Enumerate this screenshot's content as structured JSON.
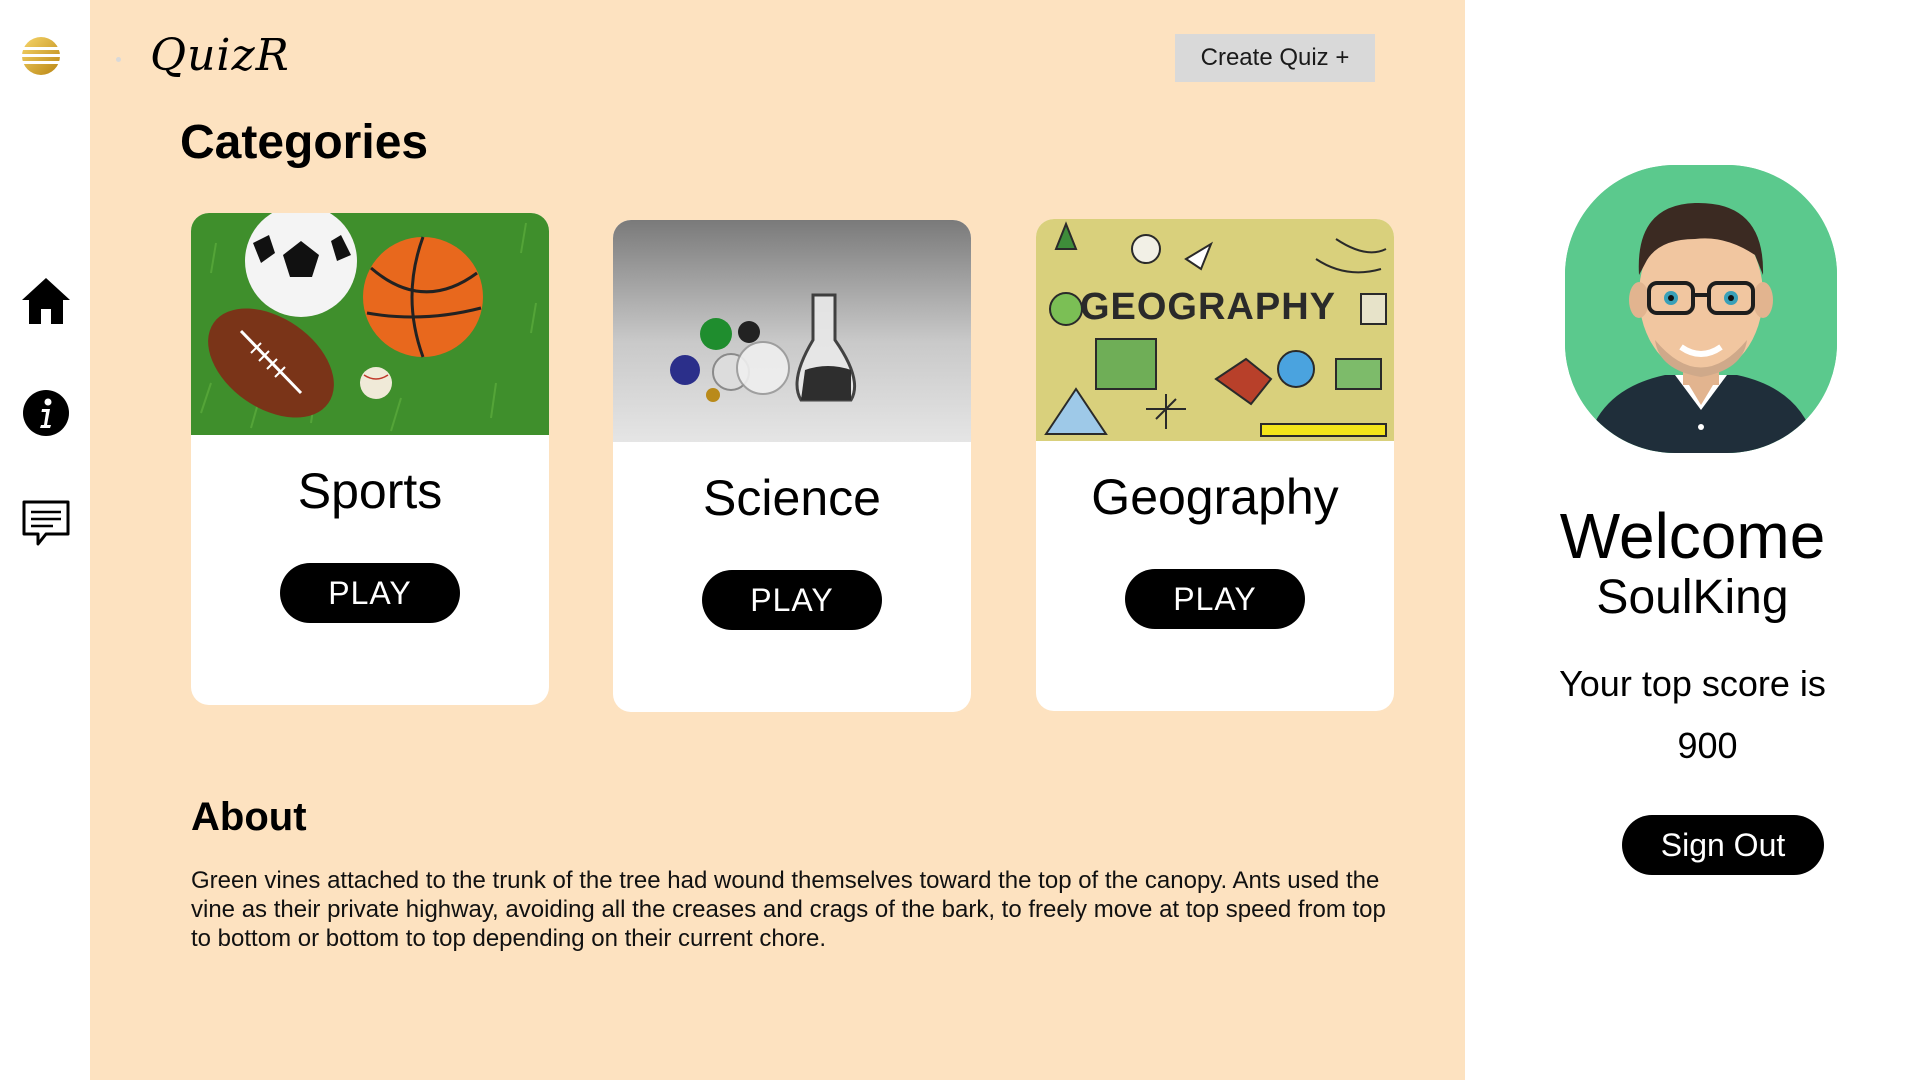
{
  "app": {
    "brand": "QuizR"
  },
  "colors": {
    "main_background": "#fde2c0",
    "card_background": "#ffffff",
    "button_background": "#000000",
    "avatar_background": "#5bc98d",
    "create_button_background": "#d9d9d9"
  },
  "rail": {
    "icons": [
      "logo-icon",
      "home-icon",
      "info-icon",
      "chat-icon"
    ]
  },
  "header": {
    "create_label": "Create Quiz +"
  },
  "categories": {
    "title": "Categories",
    "items": [
      {
        "name": "Sports",
        "play_label": "PLAY"
      },
      {
        "name": "Science",
        "play_label": "PLAY"
      },
      {
        "name": "Geography",
        "play_label": "PLAY"
      }
    ],
    "thumb_texts": {
      "geography": "GEOGRAPHY"
    }
  },
  "about": {
    "title": "About",
    "text": "Green vines attached to the trunk of the tree had wound themselves toward the top of the canopy. Ants used the vine as their private highway, avoiding all the creases and crags of the bark, to freely move at top speed from top to bottom or bottom to top depending on their current chore."
  },
  "profile": {
    "welcome": "Welcome",
    "username": "SoulKing",
    "score_label": "Your top score is",
    "score": "900",
    "signout_label": "Sign Out"
  }
}
